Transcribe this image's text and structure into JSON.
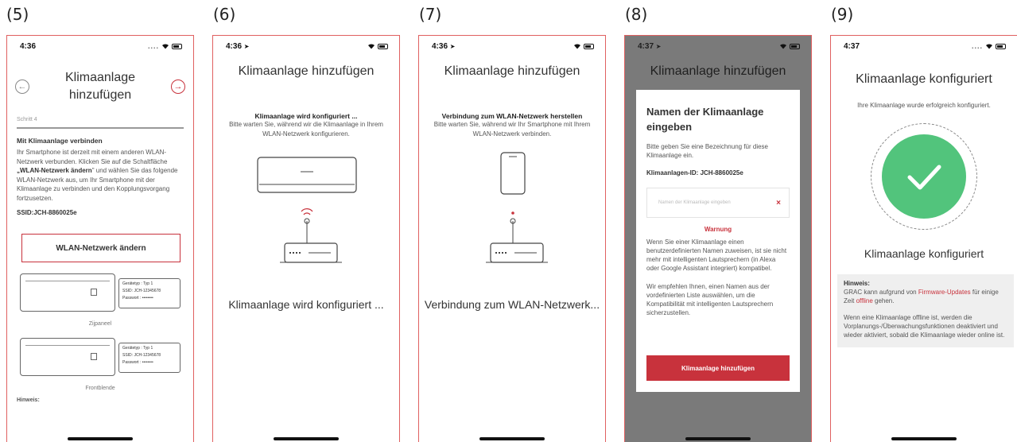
{
  "labels": [
    "(5)",
    "(6)",
    "(7)",
    "(8)",
    "(9)"
  ],
  "colors": {
    "accent": "#c8323c",
    "success": "#52c47c",
    "frame": "#e06060"
  },
  "p5": {
    "time": "4:36",
    "title": "Klimaanlage hinzufügen",
    "step": "Schritt 4",
    "heading": "Mit Klimaanlage verbinden",
    "body_a": "Ihr Smartphone ist derzeit mit einem anderen WLAN-Netzwerk verbunden. Klicken Sie auf die Schaltfläche ",
    "body_bold": "„WLAN-Netzwerk ändern",
    "body_b": "\" und wählen Sie das folgende WLAN-Netzwerk aus, um Ihr Smartphone mit der Klimaanlage zu verbinden und den Kopplungsvorgang fortzusetzen.",
    "ssid": "SSID:JCH-8860025e",
    "button": "WLAN-Netzwerk ändern",
    "unit1": {
      "caption": "Zijpaneel",
      "l1": "Gerätetyp : Typ 1",
      "l2": "SSID: JCH-12345678",
      "l3": "Passwort : ••••••••"
    },
    "unit2": {
      "caption": "Frontblende",
      "l1": "Gerätetyp : Typ 1",
      "l2": "SSID: JCH-12345678",
      "l3": "Passwort : ••••••••"
    },
    "cut": "Hinweis:",
    "icons": {
      "back": "arrow-left-icon",
      "next": "arrow-right-icon"
    }
  },
  "p6": {
    "time": "4:36",
    "title": "Klimaanlage hinzufügen",
    "status_heading": "Klimaanlage wird konfiguriert ...",
    "status_text": "Bitte warten Sie, während wir die Klimaanlage in Ihrem WLAN-Netzwerk konfigurieren.",
    "bottom": "Klimaanlage wird konfiguriert ..."
  },
  "p7": {
    "time": "4:36",
    "title": "Klimaanlage hinzufügen",
    "status_heading": "Verbindung zum WLAN-Netzwerk herstellen",
    "status_text": "Bitte warten Sie, während wir Ihr Smartphone mit Ihrem WLAN-Netzwerk verbinden.",
    "bottom": "Verbindung zum WLAN-Netzwerk..."
  },
  "p8": {
    "time": "4:37",
    "title": "Klimaanlage hinzufügen",
    "modal_heading": "Namen der Klimaanlage eingeben",
    "modal_text": "Bitte geben Sie eine Bezeichnung für diese Klimaanlage ein.",
    "id_label": "Klimaanlagen-ID: JCH-8860025e",
    "input_placeholder": "Namen der Klimaanlage eingeben",
    "warning_title": "Warnung",
    "warning_text_1": "Wenn Sie einer Klimaanlage einen benutzerdefinierten Namen zuweisen, ist sie nicht mehr mit intelligenten Lautsprechern (in Alexa oder Google Assistant integriert) kompatibel.",
    "warning_text_2": "Wir empfehlen Ihnen, einen Namen aus der vordefinierten Liste auswählen, um die Kompatibilität mit intelligenten Lautsprechern sicherzustellen.",
    "button": "Klimaanlage hinzufügen"
  },
  "p9": {
    "time": "4:37",
    "title": "Klimaanlage konfiguriert",
    "subtitle": "Ihre Klimaanlage wurde erfolgreich konfiguriert.",
    "big_title": "Klimaanlage konfiguriert",
    "hint_heading": "Hinweis:",
    "hint_a": "GRAC kann aufgrund von ",
    "hint_link1": "Firmware-Updates",
    "hint_b": " für einige Zeit ",
    "hint_link2": "offline",
    "hint_c": " gehen.",
    "hint_2": "Wenn eine Klimaanlage offline ist, werden die Vorplanungs-/Überwachungsfunktionen deaktiviert und wieder aktiviert, sobald die Klimaanlage wieder online ist."
  }
}
